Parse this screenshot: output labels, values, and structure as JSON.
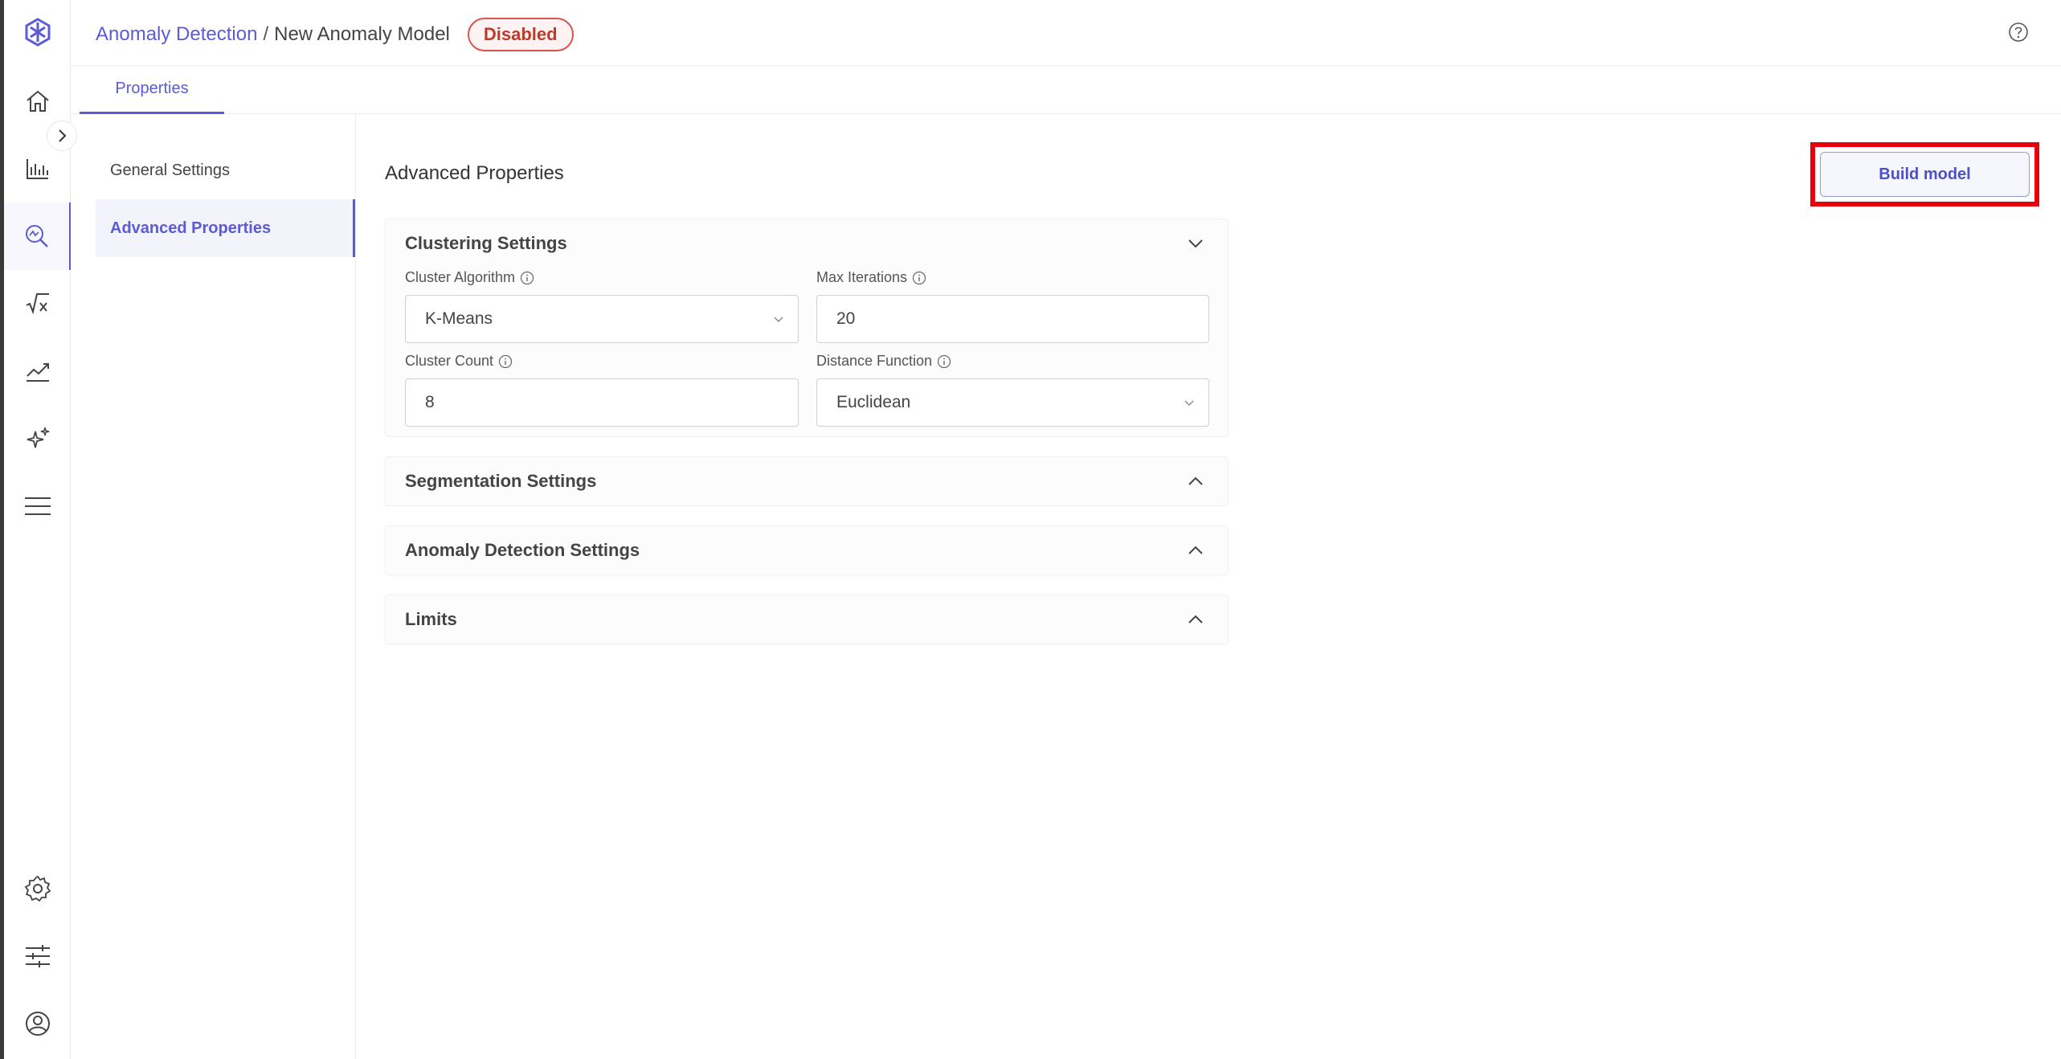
{
  "header": {
    "breadcrumb_root": "Anomaly Detection",
    "breadcrumb_sep": "/",
    "breadcrumb_current": "New Anomaly Model",
    "status_badge": "Disabled"
  },
  "tabs": {
    "properties": "Properties"
  },
  "sidenav": {
    "general": "General Settings",
    "advanced": "Advanced Properties"
  },
  "main": {
    "title": "Advanced Properties",
    "build_button": "Build model"
  },
  "clustering": {
    "title": "Clustering Settings",
    "algorithm_label": "Cluster Algorithm",
    "algorithm_value": "K-Means",
    "iterations_label": "Max Iterations",
    "iterations_value": "20",
    "count_label": "Cluster Count",
    "count_value": "8",
    "distance_label": "Distance Function",
    "distance_value": "Euclidean"
  },
  "sections": {
    "segmentation": "Segmentation Settings",
    "anomaly": "Anomaly Detection Settings",
    "limits": "Limits"
  },
  "colors": {
    "accent": "#5b5bd6",
    "danger": "#c0392b",
    "highlight": "#e8000b"
  }
}
